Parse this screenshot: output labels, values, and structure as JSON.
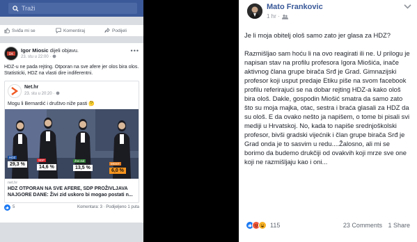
{
  "mobile": {
    "search": {
      "placeholder": "Traži"
    },
    "top_actions": {
      "like": "Sviđa mi se",
      "comment": "Komentiraj",
      "share": "Podijeli"
    },
    "post": {
      "author": "Igor Miosic",
      "action": "dijeli objavu.",
      "time": "23. stu u 22:00 ·",
      "text": "HDZ-u ne pada rejting. Otporan na sve afere jer olos bira olos. Statisticki, HDZ na vlasti dire indiferentni.",
      "shared": {
        "page_name": "Net.hr",
        "page_time": "23. stu u 20:20 ·",
        "caption": "Mogu li Bernardić i društvo niže pasti 🤔",
        "poll_values": [
          "29,3 %",
          "14,6 %",
          "13,5 %",
          "6,0 %"
        ],
        "poll_tags": [
          "HDZ",
          "SDP",
          "Živi zid",
          "MOST"
        ],
        "link_source": "net.hr",
        "link_title": "HDZ OTPORAN NA SVE AFERE, SDP PROŽIVLJAVA NAJGORE DANE: Živi zid uskoro bi mogao postati n..."
      },
      "footer": {
        "likes": "5",
        "stats": "Komentara: 3 · Podijeljeno 1 puta"
      }
    }
  },
  "desktop": {
    "author": "Mato Frankovic",
    "time": "1 hr ·",
    "paragraph1": "Je li moja obitelj ološ samo zato jer glasa za HDZ?",
    "paragraph2": "Razmišljao sam hoću li na ovo reagirati ili ne. U prilogu je napisan stav na profilu profesora Igora Miošića, inače aktivnog člana grupe birača Srđ je Grad. Gimnazijski profesor koji usput predaje Etiku piše na svom facebook profilu referirajući se na dobar rejting HDZ-a kako ološ bira ološ. Dakle, gospodin Miošić smatra da samo zato što su moja majka, otac, sestra i braća glasali za HDZ da su ološ. E da ovako nešto ja napišem, o tome bi pisali svi mediji u Hrvatskoj. No, kada to napiše srednjoškolski profesor, bivši gradski vijećnik i član grupe birača Srđ je Grad onda je to sasvim u redu....Žalosno, ali mi se borimo da budemo drukčiji od ovakvih koji mrze sve one koji ne razmišljaju kao i oni...",
    "reaction_count": "115",
    "comments": "23 Comments",
    "shares": "1 Share",
    "colors": {
      "name": "#385898",
      "like": "#1877f2",
      "angry": "#f0573b",
      "haha": "#f7b125"
    }
  }
}
